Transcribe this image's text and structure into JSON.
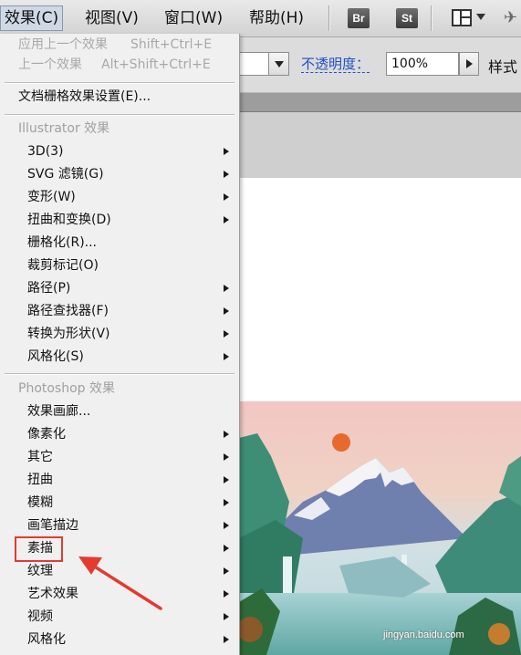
{
  "menubar": {
    "items": [
      {
        "label": "效果(C)"
      },
      {
        "label": "视图(V)"
      },
      {
        "label": "窗口(W)"
      },
      {
        "label": "帮助(H)"
      }
    ],
    "apps": [
      {
        "label": "Br"
      },
      {
        "label": "St"
      }
    ],
    "icons": {
      "layout": "workspace-layout-icon",
      "wing": "feather-icon"
    }
  },
  "controlbar": {
    "opacity_label": "不透明度：",
    "opacity_value": "100%",
    "style_label": "样式"
  },
  "menu": {
    "recent": [
      {
        "label": "应用上一个效果",
        "shortcut": "Shift+Ctrl+E"
      },
      {
        "label": "上一个效果",
        "shortcut": "Alt+Shift+Ctrl+E"
      }
    ],
    "raster_settings": "文档栅格效果设置(E)...",
    "illustrator_header": "Illustrator 效果",
    "illustrator_items": [
      {
        "label": "3D(3)",
        "submenu": true
      },
      {
        "label": "SVG 滤镜(G)",
        "submenu": true
      },
      {
        "label": "变形(W)",
        "submenu": true
      },
      {
        "label": "扭曲和变换(D)",
        "submenu": true
      },
      {
        "label": "栅格化(R)...",
        "submenu": false
      },
      {
        "label": "裁剪标记(O)",
        "submenu": false
      },
      {
        "label": "路径(P)",
        "submenu": true
      },
      {
        "label": "路径查找器(F)",
        "submenu": true
      },
      {
        "label": "转换为形状(V)",
        "submenu": true
      },
      {
        "label": "风格化(S)",
        "submenu": true
      }
    ],
    "photoshop_header": "Photoshop 效果",
    "photoshop_items": [
      {
        "label": "效果画廊...",
        "submenu": false
      },
      {
        "label": "像素化",
        "submenu": true
      },
      {
        "label": "其它",
        "submenu": true
      },
      {
        "label": "扭曲",
        "submenu": true
      },
      {
        "label": "模糊",
        "submenu": true
      },
      {
        "label": "画笔描边",
        "submenu": true
      },
      {
        "label": "素描",
        "submenu": true
      },
      {
        "label": "纹理",
        "submenu": true
      },
      {
        "label": "艺术效果",
        "submenu": true
      },
      {
        "label": "视频",
        "submenu": true
      },
      {
        "label": "风格化",
        "submenu": true
      }
    ]
  },
  "annotation": {
    "highlight_color": "#e33b2f"
  },
  "watermark": "jingyan.baidu.com"
}
